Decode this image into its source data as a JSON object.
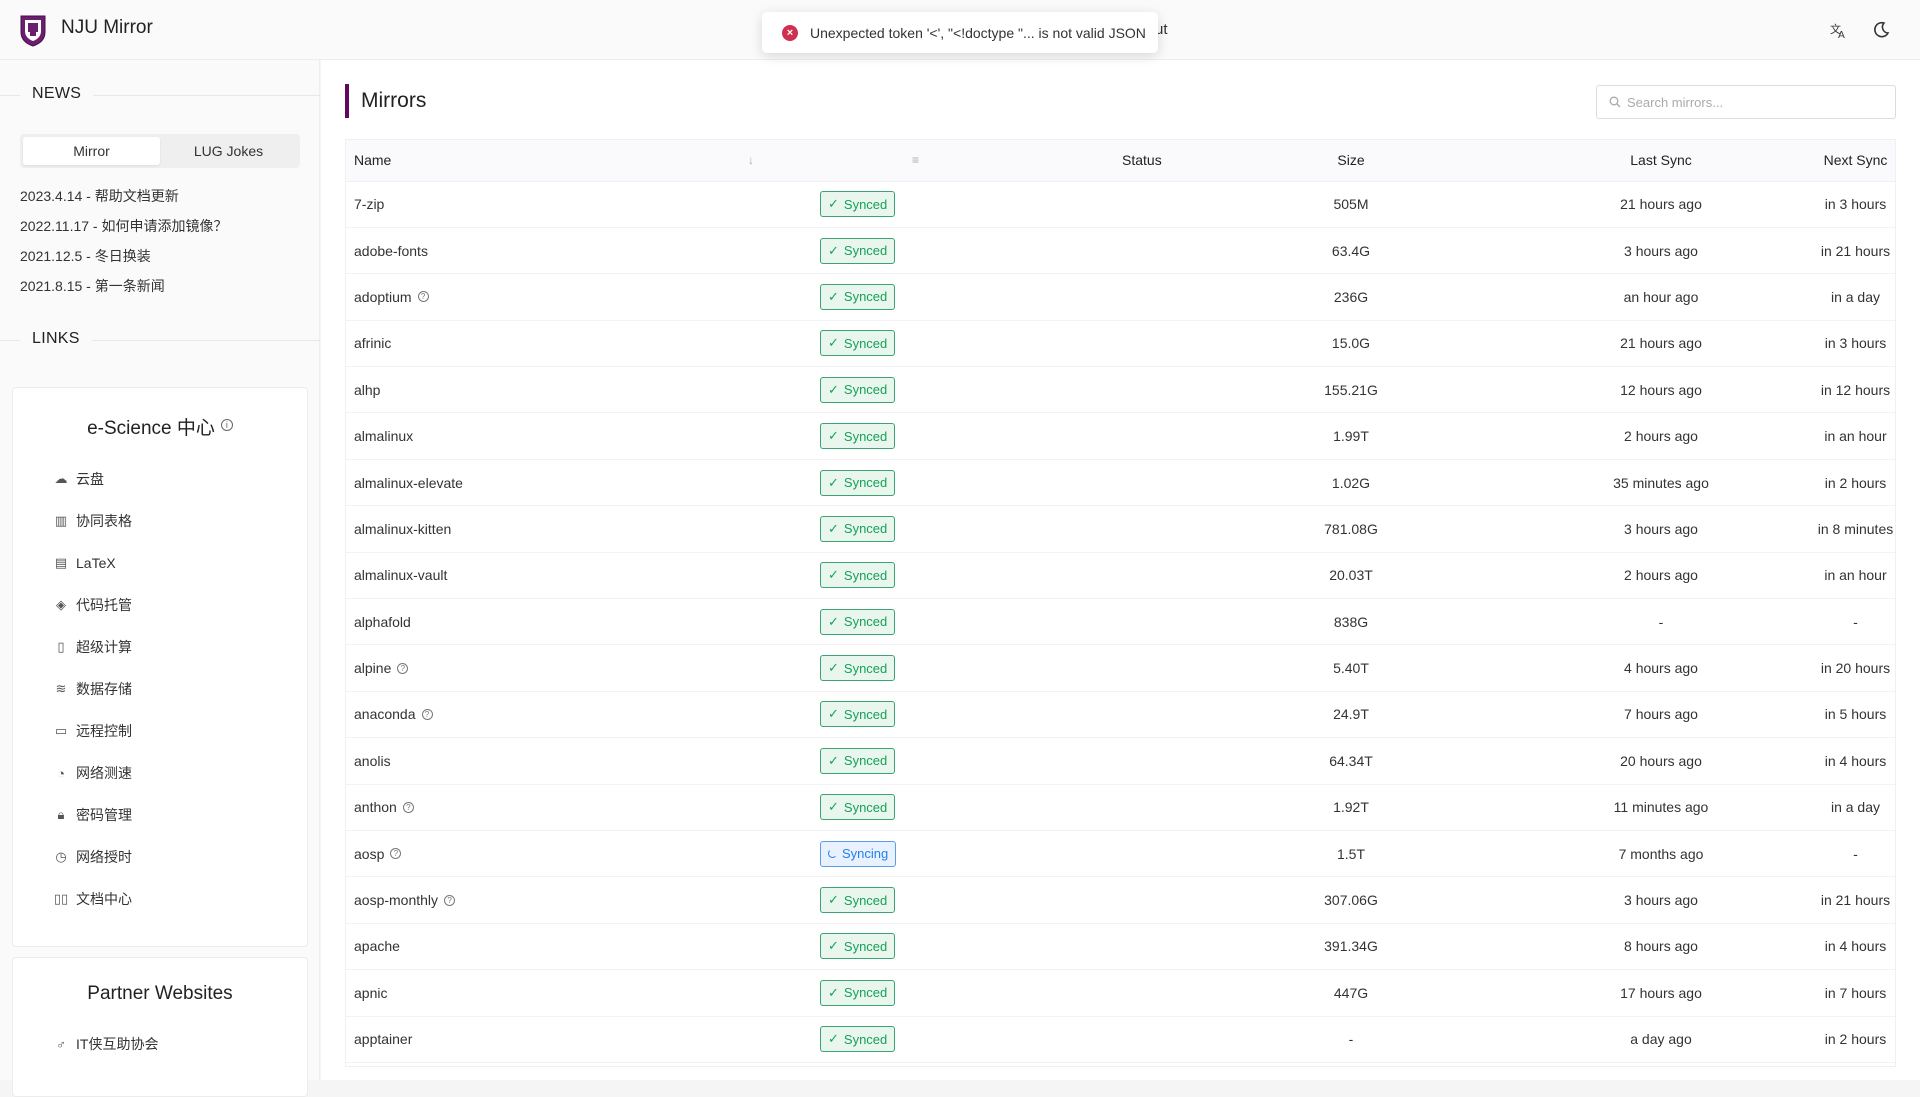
{
  "header": {
    "brand": "NJU Mirror",
    "about_fragment": "ut",
    "toast_message": "Unexpected token '<', \"<!doctype \"... is not valid JSON",
    "translate_icon": "translate-icon",
    "theme_icon": "moon-icon"
  },
  "sidebar": {
    "news_label": "NEWS",
    "tabs": [
      {
        "label": "Mirror",
        "active": true
      },
      {
        "label": "LUG Jokes",
        "active": false
      }
    ],
    "news_items": [
      "2023.4.14 - 帮助文档更新",
      "2022.11.17 - 如何申请添加镜像？",
      "2021.12.5 - 冬日换装",
      "2021.8.15 - 第一条新闻"
    ],
    "links_label": "LINKS",
    "escience": {
      "title": "e-Science 中心",
      "items": [
        {
          "label": "云盘",
          "icon": "cloud-upload-icon"
        },
        {
          "label": "协同表格",
          "icon": "bar-chart-icon"
        },
        {
          "label": "LaTeX",
          "icon": "document-icon"
        },
        {
          "label": "代码托管",
          "icon": "gitlab-icon"
        },
        {
          "label": "超级计算",
          "icon": "server-icon"
        },
        {
          "label": "数据存储",
          "icon": "database-icon"
        },
        {
          "label": "远程控制",
          "icon": "monitor-icon"
        },
        {
          "label": "网络测速",
          "icon": "speedometer-icon"
        },
        {
          "label": "密码管理",
          "icon": "lock-icon"
        },
        {
          "label": "网络授时",
          "icon": "clock-icon"
        },
        {
          "label": "文档中心",
          "icon": "book-icon"
        }
      ]
    },
    "partner": {
      "title": "Partner Websites",
      "items": [
        {
          "label": "IT侠互助协会",
          "icon": "male-icon"
        }
      ]
    }
  },
  "main": {
    "title": "Mirrors",
    "search_placeholder": "Search mirrors...",
    "columns": {
      "name": "Name",
      "status": "Status",
      "size": "Size",
      "last_sync": "Last Sync",
      "next_sync": "Next Sync"
    },
    "rows": [
      {
        "name": "7-zip",
        "help": false,
        "status": "Synced",
        "size": "505M",
        "last": "21 hours ago",
        "next": "in 3 hours"
      },
      {
        "name": "adobe-fonts",
        "help": false,
        "status": "Synced",
        "size": "63.4G",
        "last": "3 hours ago",
        "next": "in 21 hours"
      },
      {
        "name": "adoptium",
        "help": true,
        "status": "Synced",
        "size": "236G",
        "last": "an hour ago",
        "next": "in a day"
      },
      {
        "name": "afrinic",
        "help": false,
        "status": "Synced",
        "size": "15.0G",
        "last": "21 hours ago",
        "next": "in 3 hours"
      },
      {
        "name": "alhp",
        "help": false,
        "status": "Synced",
        "size": "155.21G",
        "last": "12 hours ago",
        "next": "in 12 hours"
      },
      {
        "name": "almalinux",
        "help": false,
        "status": "Synced",
        "size": "1.99T",
        "last": "2 hours ago",
        "next": "in an hour"
      },
      {
        "name": "almalinux-elevate",
        "help": false,
        "status": "Synced",
        "size": "1.02G",
        "last": "35 minutes ago",
        "next": "in 2 hours"
      },
      {
        "name": "almalinux-kitten",
        "help": false,
        "status": "Synced",
        "size": "781.08G",
        "last": "3 hours ago",
        "next": "in 8 minutes"
      },
      {
        "name": "almalinux-vault",
        "help": false,
        "status": "Synced",
        "size": "20.03T",
        "last": "2 hours ago",
        "next": "in an hour"
      },
      {
        "name": "alphafold",
        "help": false,
        "status": "Synced",
        "size": "838G",
        "last": "-",
        "next": "-"
      },
      {
        "name": "alpine",
        "help": true,
        "status": "Synced",
        "size": "5.40T",
        "last": "4 hours ago",
        "next": "in 20 hours"
      },
      {
        "name": "anaconda",
        "help": true,
        "status": "Synced",
        "size": "24.9T",
        "last": "7 hours ago",
        "next": "in 5 hours"
      },
      {
        "name": "anolis",
        "help": false,
        "status": "Synced",
        "size": "64.34T",
        "last": "20 hours ago",
        "next": "in 4 hours"
      },
      {
        "name": "anthon",
        "help": true,
        "status": "Synced",
        "size": "1.92T",
        "last": "11 minutes ago",
        "next": "in a day"
      },
      {
        "name": "aosp",
        "help": true,
        "status": "Syncing",
        "size": "1.5T",
        "last": "7 months ago",
        "next": "-"
      },
      {
        "name": "aosp-monthly",
        "help": true,
        "status": "Synced",
        "size": "307.06G",
        "last": "3 hours ago",
        "next": "in 21 hours"
      },
      {
        "name": "apache",
        "help": false,
        "status": "Synced",
        "size": "391.34G",
        "last": "8 hours ago",
        "next": "in 4 hours"
      },
      {
        "name": "apnic",
        "help": false,
        "status": "Synced",
        "size": "447G",
        "last": "17 hours ago",
        "next": "in 7 hours"
      },
      {
        "name": "apptainer",
        "help": false,
        "status": "Synced",
        "size": "-",
        "last": "a day ago",
        "next": "in 2 hours"
      }
    ]
  },
  "colors": {
    "accent": "#63065f",
    "synced": "#18a058",
    "syncing": "#2080f0",
    "error": "#d03050"
  }
}
